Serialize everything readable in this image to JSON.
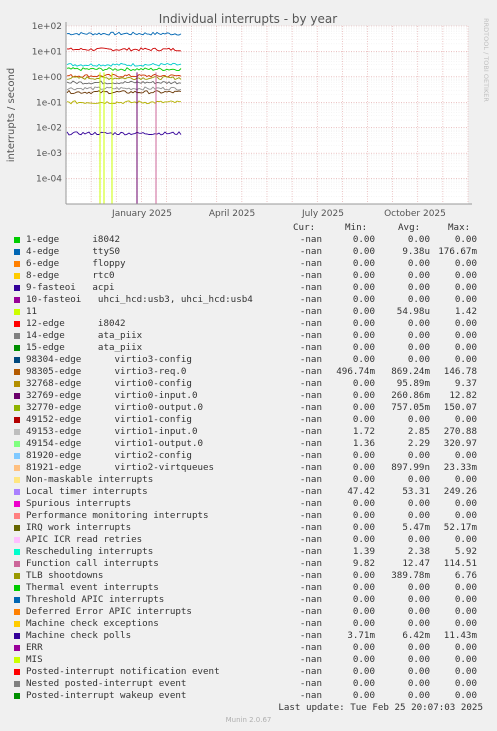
{
  "chart_data": {
    "type": "line",
    "title": "Individual interrupts - by year",
    "ylabel": "interrupts / second",
    "side_label": "RRDTOOL / TOBI OETIKER",
    "y_scale": "log",
    "ylim": [
      1e-05,
      100
    ],
    "y_ticks": [
      "1e+02",
      "1e+01",
      "1e+00",
      "1e-01",
      "1e-02",
      "1e-03",
      "1e-04"
    ],
    "x_ticks": [
      "January 2025",
      "April 2025",
      "July 2025",
      "October 2025"
    ],
    "grid": true,
    "series_approx_levels": [
      {
        "color": "#0066b3",
        "value": 50
      },
      {
        "color": "#cc0000",
        "value": 12
      },
      {
        "color": "#00cccc",
        "value": 3
      },
      {
        "color": "#00cc00",
        "value": 2
      },
      {
        "color": "#cc3300",
        "value": 1.1
      },
      {
        "color": "#999900",
        "value": 0.9
      },
      {
        "color": "#666666",
        "value": 0.6
      },
      {
        "color": "#8f8f8f",
        "value": 0.35
      },
      {
        "color": "#663300",
        "value": 0.25
      },
      {
        "color": "#b3b300",
        "value": 0.1
      },
      {
        "color": "#330099",
        "value": 0.006
      }
    ]
  },
  "legend": {
    "headers": {
      "cur": "Cur:",
      "min": "Min:",
      "avg": "Avg:",
      "max": "Max:"
    },
    "rows": [
      {
        "name": "1-edge      i8042",
        "color": "#00cc00",
        "cur": "-nan",
        "min": "0.00",
        "avg": "0.00",
        "max": "0.00"
      },
      {
        "name": "4-edge      ttyS0",
        "color": "#0066b3",
        "cur": "-nan",
        "min": "0.00",
        "avg": "9.38u",
        "max": "176.67m"
      },
      {
        "name": "6-edge      floppy",
        "color": "#ff8000",
        "cur": "-nan",
        "min": "0.00",
        "avg": "0.00",
        "max": "0.00"
      },
      {
        "name": "8-edge      rtc0",
        "color": "#ffcc00",
        "cur": "-nan",
        "min": "0.00",
        "avg": "0.00",
        "max": "0.00"
      },
      {
        "name": "9-fasteoi   acpi",
        "color": "#330099",
        "cur": "-nan",
        "min": "0.00",
        "avg": "0.00",
        "max": "0.00"
      },
      {
        "name": "10-fasteoi   uhci_hcd:usb3, uhci_hcd:usb4",
        "color": "#990099",
        "cur": "-nan",
        "min": "0.00",
        "avg": "0.00",
        "max": "0.00"
      },
      {
        "name": "11",
        "color": "#ccff00",
        "cur": "-nan",
        "min": "0.00",
        "avg": "54.98u",
        "max": "1.42"
      },
      {
        "name": "12-edge      i8042",
        "color": "#ff0000",
        "cur": "-nan",
        "min": "0.00",
        "avg": "0.00",
        "max": "0.00"
      },
      {
        "name": "14-edge      ata_piix",
        "color": "#808080",
        "cur": "-nan",
        "min": "0.00",
        "avg": "0.00",
        "max": "0.00"
      },
      {
        "name": "15-edge      ata_piix",
        "color": "#008f00",
        "cur": "-nan",
        "min": "0.00",
        "avg": "0.00",
        "max": "0.00"
      },
      {
        "name": "98304-edge      virtio3-config",
        "color": "#00487d",
        "cur": "-nan",
        "min": "0.00",
        "avg": "0.00",
        "max": "0.00"
      },
      {
        "name": "98305-edge      virtio3-req.0",
        "color": "#b35a00",
        "cur": "-nan",
        "min": "496.74m",
        "avg": "869.24m",
        "max": "146.78"
      },
      {
        "name": "32768-edge      virtio0-config",
        "color": "#b38f00",
        "cur": "-nan",
        "min": "0.00",
        "avg": "95.89m",
        "max": "9.37"
      },
      {
        "name": "32769-edge      virtio0-input.0",
        "color": "#6b006b",
        "cur": "-nan",
        "min": "0.00",
        "avg": "260.86m",
        "max": "12.82"
      },
      {
        "name": "32770-edge      virtio0-output.0",
        "color": "#8fb300",
        "cur": "-nan",
        "min": "0.00",
        "avg": "757.05m",
        "max": "150.07"
      },
      {
        "name": "49152-edge      virtio1-config",
        "color": "#b30000",
        "cur": "-nan",
        "min": "0.00",
        "avg": "0.00",
        "max": "0.00"
      },
      {
        "name": "49153-edge      virtio1-input.0",
        "color": "#bebebe",
        "cur": "-nan",
        "min": "1.72",
        "avg": "2.85",
        "max": "270.88"
      },
      {
        "name": "49154-edge      virtio1-output.0",
        "color": "#80ff80",
        "cur": "-nan",
        "min": "1.36",
        "avg": "2.29",
        "max": "320.97"
      },
      {
        "name": "81920-edge      virtio2-config",
        "color": "#80c9ff",
        "cur": "-nan",
        "min": "0.00",
        "avg": "0.00",
        "max": "0.00"
      },
      {
        "name": "81921-edge      virtio2-virtqueues",
        "color": "#ffc080",
        "cur": "-nan",
        "min": "0.00",
        "avg": "897.99n",
        "max": "23.33m"
      },
      {
        "name": "Non-maskable interrupts",
        "color": "#ffe680",
        "cur": "-nan",
        "min": "0.00",
        "avg": "0.00",
        "max": "0.00"
      },
      {
        "name": "Local timer interrupts",
        "color": "#aa80ff",
        "cur": "-nan",
        "min": "47.42",
        "avg": "53.31",
        "max": "249.26"
      },
      {
        "name": "Spurious interrupts",
        "color": "#ee00cc",
        "cur": "-nan",
        "min": "0.00",
        "avg": "0.00",
        "max": "0.00"
      },
      {
        "name": "Performance monitoring interrupts",
        "color": "#ff8080",
        "cur": "-nan",
        "min": "0.00",
        "avg": "0.00",
        "max": "0.00"
      },
      {
        "name": "IRQ work interrupts",
        "color": "#666600",
        "cur": "-nan",
        "min": "0.00",
        "avg": "5.47m",
        "max": "52.17m"
      },
      {
        "name": "APIC ICR read retries",
        "color": "#ffbfff",
        "cur": "-nan",
        "min": "0.00",
        "avg": "0.00",
        "max": "0.00"
      },
      {
        "name": "Rescheduling interrupts",
        "color": "#00ffcc",
        "cur": "-nan",
        "min": "1.39",
        "avg": "2.38",
        "max": "5.92"
      },
      {
        "name": "Function call interrupts",
        "color": "#cc6699",
        "cur": "-nan",
        "min": "9.82",
        "avg": "12.47",
        "max": "114.51"
      },
      {
        "name": "TLB shootdowns",
        "color": "#999900",
        "cur": "-nan",
        "min": "0.00",
        "avg": "389.78m",
        "max": "6.76"
      },
      {
        "name": "Thermal event interrupts",
        "color": "#00cc00",
        "cur": "-nan",
        "min": "0.00",
        "avg": "0.00",
        "max": "0.00"
      },
      {
        "name": "Threshold APIC interrupts",
        "color": "#0066b3",
        "cur": "-nan",
        "min": "0.00",
        "avg": "0.00",
        "max": "0.00"
      },
      {
        "name": "Deferred Error APIC interrupts",
        "color": "#ff8000",
        "cur": "-nan",
        "min": "0.00",
        "avg": "0.00",
        "max": "0.00"
      },
      {
        "name": "Machine check exceptions",
        "color": "#ffcc00",
        "cur": "-nan",
        "min": "0.00",
        "avg": "0.00",
        "max": "0.00"
      },
      {
        "name": "Machine check polls",
        "color": "#330099",
        "cur": "-nan",
        "min": "3.71m",
        "avg": "6.42m",
        "max": "11.43m"
      },
      {
        "name": "ERR",
        "color": "#990099",
        "cur": "-nan",
        "min": "0.00",
        "avg": "0.00",
        "max": "0.00"
      },
      {
        "name": "MIS",
        "color": "#ccff00",
        "cur": "-nan",
        "min": "0.00",
        "avg": "0.00",
        "max": "0.00"
      },
      {
        "name": "Posted-interrupt notification event",
        "color": "#ff0000",
        "cur": "-nan",
        "min": "0.00",
        "avg": "0.00",
        "max": "0.00"
      },
      {
        "name": "Nested posted-interrupt event",
        "color": "#808080",
        "cur": "-nan",
        "min": "0.00",
        "avg": "0.00",
        "max": "0.00"
      },
      {
        "name": "Posted-interrupt wakeup event",
        "color": "#008f00",
        "cur": "-nan",
        "min": "0.00",
        "avg": "0.00",
        "max": "0.00"
      }
    ]
  },
  "last_update": "Last update: Tue Feb 25 20:07:03 2025",
  "footer": "Munin 2.0.67"
}
